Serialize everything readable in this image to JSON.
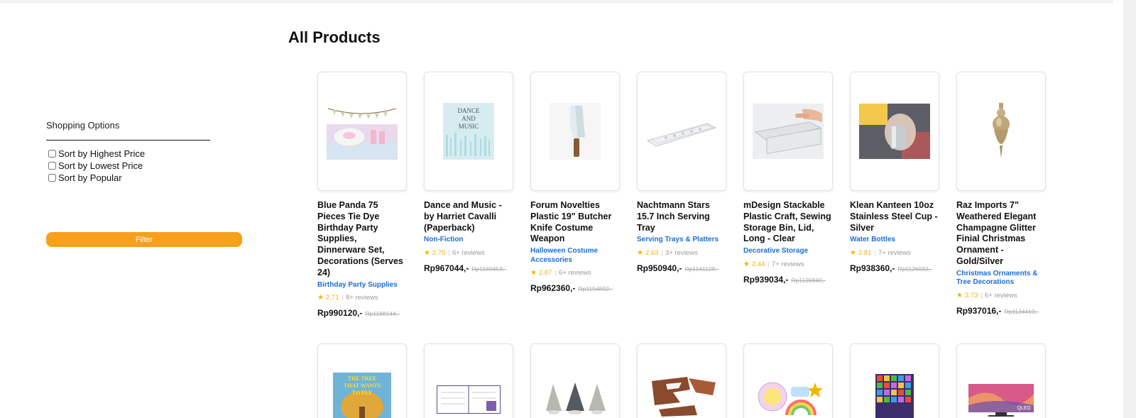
{
  "page_title": "All Products",
  "sidebar": {
    "heading": "Shopping Options",
    "options": [
      {
        "label": "Sort by Highest Price",
        "checked": false
      },
      {
        "label": "Sort by Lowest Price",
        "checked": false
      },
      {
        "label": "Sort by Popular",
        "checked": false
      }
    ],
    "filter_label": "Filter"
  },
  "products": [
    {
      "name": "Blue Panda 75 Pieces Tie Dye Birthday Party Supplies, Dinnerware Set, Decorations (Serves 24)",
      "category": "Birthday Party Supplies",
      "rating": "2.71",
      "reviews": "8+ reviews",
      "price": "Rp990120,-",
      "old_price": "Rp1188144,-",
      "image": "party-supplies-image"
    },
    {
      "name": "Dance and Music - by Harriet Cavalli (Paperback)",
      "category": "Non-Fiction",
      "rating": "2.75",
      "reviews": "6+ reviews",
      "price": "Rp967044,-",
      "old_price": "Rp1160453,-",
      "image": "book-cover-image",
      "cover_text": "DANCE AND MUSIC"
    },
    {
      "name": "Forum Novelties Plastic 19\" Butcher Knife Costume Weapon",
      "category": "Halloween Costume Accessories",
      "rating": "2.87",
      "reviews": "6+ reviews",
      "price": "Rp962360,-",
      "old_price": "Rp1154832,-",
      "image": "knife-image"
    },
    {
      "name": "Nachtmann Stars 15.7 Inch Serving Tray",
      "category": "Serving Trays & Platters",
      "rating": "2.63",
      "reviews": "3+ reviews",
      "price": "Rp950940,-",
      "old_price": "Rp1141128,-",
      "image": "tray-image"
    },
    {
      "name": "mDesign Stackable Plastic Craft, Sewing Storage Bin, Lid, Long - Clear",
      "category": "Decorative Storage",
      "rating": "2.44",
      "reviews": "7+ reviews",
      "price": "Rp939034,-",
      "old_price": "Rp1126840,-",
      "image": "storage-bin-image"
    },
    {
      "name": "Klean Kanteen 10oz Stainless Steel Cup - Silver",
      "category": "Water Bottles",
      "rating": "2.81",
      "reviews": "7+ reviews",
      "price": "Rp938360,-",
      "old_price": "Rp1126032,-",
      "image": "steel-cup-image"
    },
    {
      "name": "Raz Imports 7\" Weathered Elegant Champagne Glitter Finial Christmas Ornament - Gold/Silver",
      "category": "Christmas Ornaments & Tree Decorations",
      "rating": "3.73",
      "reviews": "6+ reviews",
      "price": "Rp937016,-",
      "old_price": "Rp1124419,-",
      "image": "ornament-image"
    }
  ],
  "products_row2": [
    {
      "image": "book-tree-image",
      "cover_text": "THE TREE THAT WANTS TO FLY"
    },
    {
      "image": "planner-image"
    },
    {
      "image": "gnome-hats-image"
    },
    {
      "image": "wood-puzzle-image"
    },
    {
      "image": "unicorn-stickers-image"
    },
    {
      "image": "pixel-poster-image"
    },
    {
      "image": "tv-image",
      "screen_text": "QLED"
    }
  ],
  "colors": {
    "accent": "#f7a01c",
    "category_link": "#1a6fd1",
    "star": "#f5b300"
  }
}
